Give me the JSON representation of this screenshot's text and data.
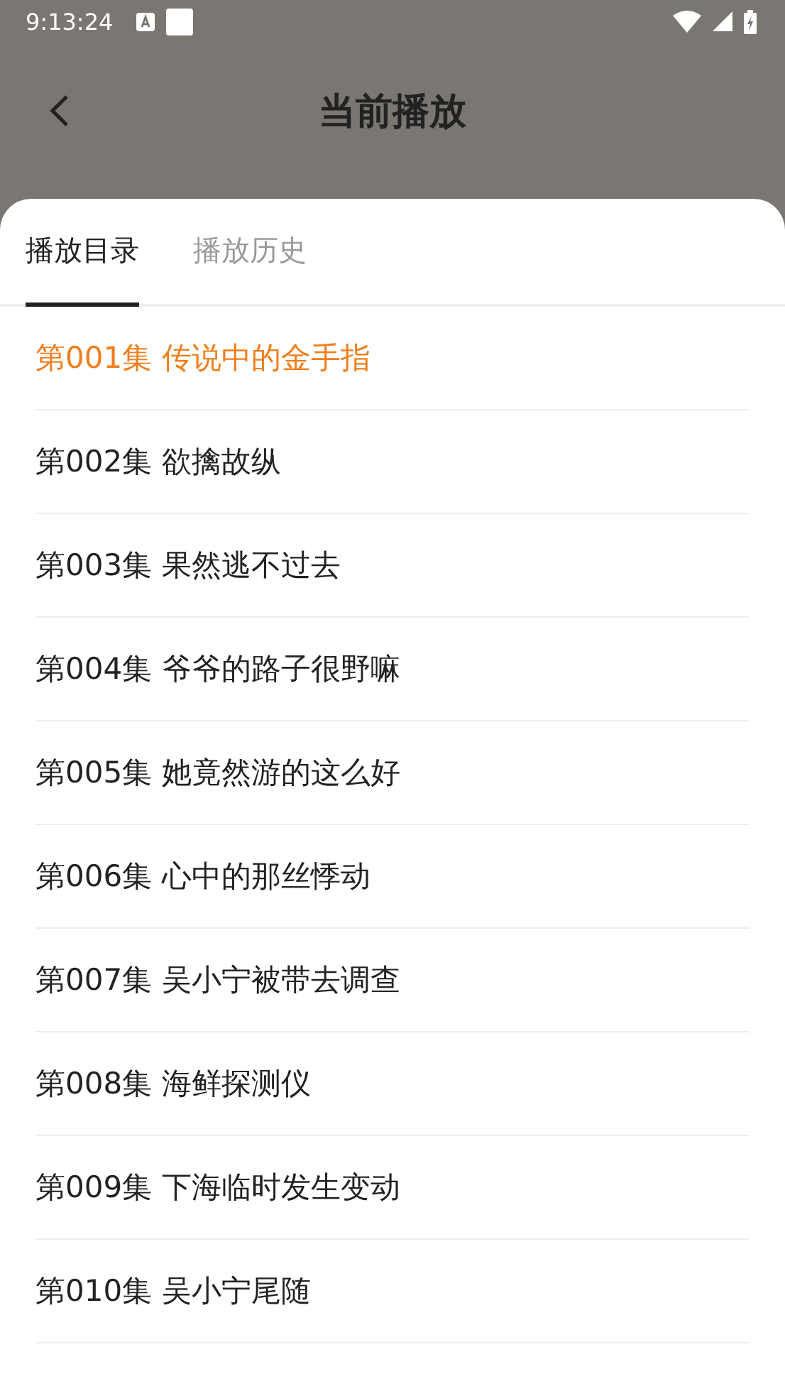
{
  "status_bar": {
    "time": "9:13:24"
  },
  "header": {
    "title": "当前播放"
  },
  "tabs": [
    {
      "label": "播放目录",
      "selected": true
    },
    {
      "label": "播放历史",
      "selected": false
    }
  ],
  "episodes": [
    {
      "title": "第001集 传说中的金手指",
      "selected": true
    },
    {
      "title": "第002集 欲擒故纵",
      "selected": false
    },
    {
      "title": "第003集 果然逃不过去",
      "selected": false
    },
    {
      "title": "第004集 爷爷的路子很野嘛",
      "selected": false
    },
    {
      "title": "第005集 她竟然游的这么好",
      "selected": false
    },
    {
      "title": "第006集 心中的那丝悸动",
      "selected": false
    },
    {
      "title": "第007集 吴小宁被带去调查",
      "selected": false
    },
    {
      "title": "第008集 海鲜探测仪",
      "selected": false
    },
    {
      "title": "第009集 下海临时发生变动",
      "selected": false
    },
    {
      "title": "第010集 吴小宁尾随",
      "selected": false
    }
  ]
}
